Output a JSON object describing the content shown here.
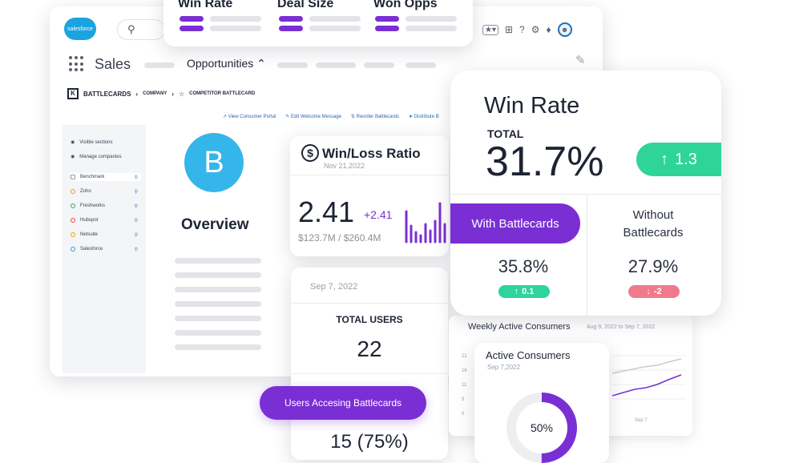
{
  "salesforce": {
    "logo_text": "salesforce",
    "app_name": "Sales",
    "active_tab": "Opportunities",
    "breadcrumb": [
      "BATTLECARDS",
      "COMPANY",
      "COMPETITOR BATTLECARD"
    ],
    "actions": [
      "View Consumer Portal",
      "Edit Welcome Message",
      "Reorder Battlecards",
      "Distribute B"
    ],
    "sidebar_items": [
      {
        "label": "Visible sections",
        "color": "#9aa0aa"
      },
      {
        "label": "Manage companies",
        "color": "#9aa0aa"
      },
      {
        "label": "Benchmark",
        "color": "#9aa0aa",
        "selected": true
      },
      {
        "label": "Zoho",
        "color": "#f39c12"
      },
      {
        "label": "Freshworks",
        "color": "#27ae60"
      },
      {
        "label": "Hubspot",
        "color": "#e74c3c"
      },
      {
        "label": "Netsuite",
        "color": "#f39c12"
      },
      {
        "label": "Salesforce",
        "color": "#1ba3e0"
      }
    ],
    "avatar_letter": "B",
    "overview_title": "Overview"
  },
  "metrics_header": {
    "labels": [
      "Win Rate",
      "Deal Size",
      "Won Opps"
    ]
  },
  "win_loss": {
    "title": "Win/Loss Ratio",
    "date": "Nov 21,2022",
    "ratio": "2.41",
    "delta": "+2.41",
    "amounts": "$123.7M / $260.4M"
  },
  "win_rate": {
    "title": "Win Rate",
    "total_label": "TOTAL",
    "total_value": "31.7%",
    "total_delta": "1.3",
    "with_label": "With Battlecards",
    "without_label": [
      "Without",
      "Battlecards"
    ],
    "with_value": "35.8%",
    "with_delta": "0.1",
    "without_value": "27.9%",
    "without_delta": "-2",
    "colors": {
      "up": "#2ed49a",
      "down": "#f07a8c",
      "accent": "#7a2fd4"
    }
  },
  "users": {
    "date": "Sep 7, 2022",
    "total_label": "TOTAL USERS",
    "total_value": "22",
    "accessing_label": "Users Accesing Battlecards",
    "accessing_value": "15 (75%)"
  },
  "weekly": {
    "title": "Weekly Active Consumers",
    "range": "Aug 9, 2022 to Sep 7, 2022",
    "axis": [
      "22",
      "16",
      "11",
      "5",
      "0"
    ],
    "x_label": "Sep 7"
  },
  "active_consumers": {
    "title": "Active Consumers",
    "date": "Sep 7,2022",
    "percent_label": "50%",
    "percent": 0.5
  },
  "icons": [
    "star-icon",
    "plus-icon",
    "help-icon",
    "gear-icon",
    "bell-icon",
    "avatar-icon",
    "search-icon",
    "pencil-icon",
    "arrow-up-icon",
    "arrow-down-icon"
  ]
}
